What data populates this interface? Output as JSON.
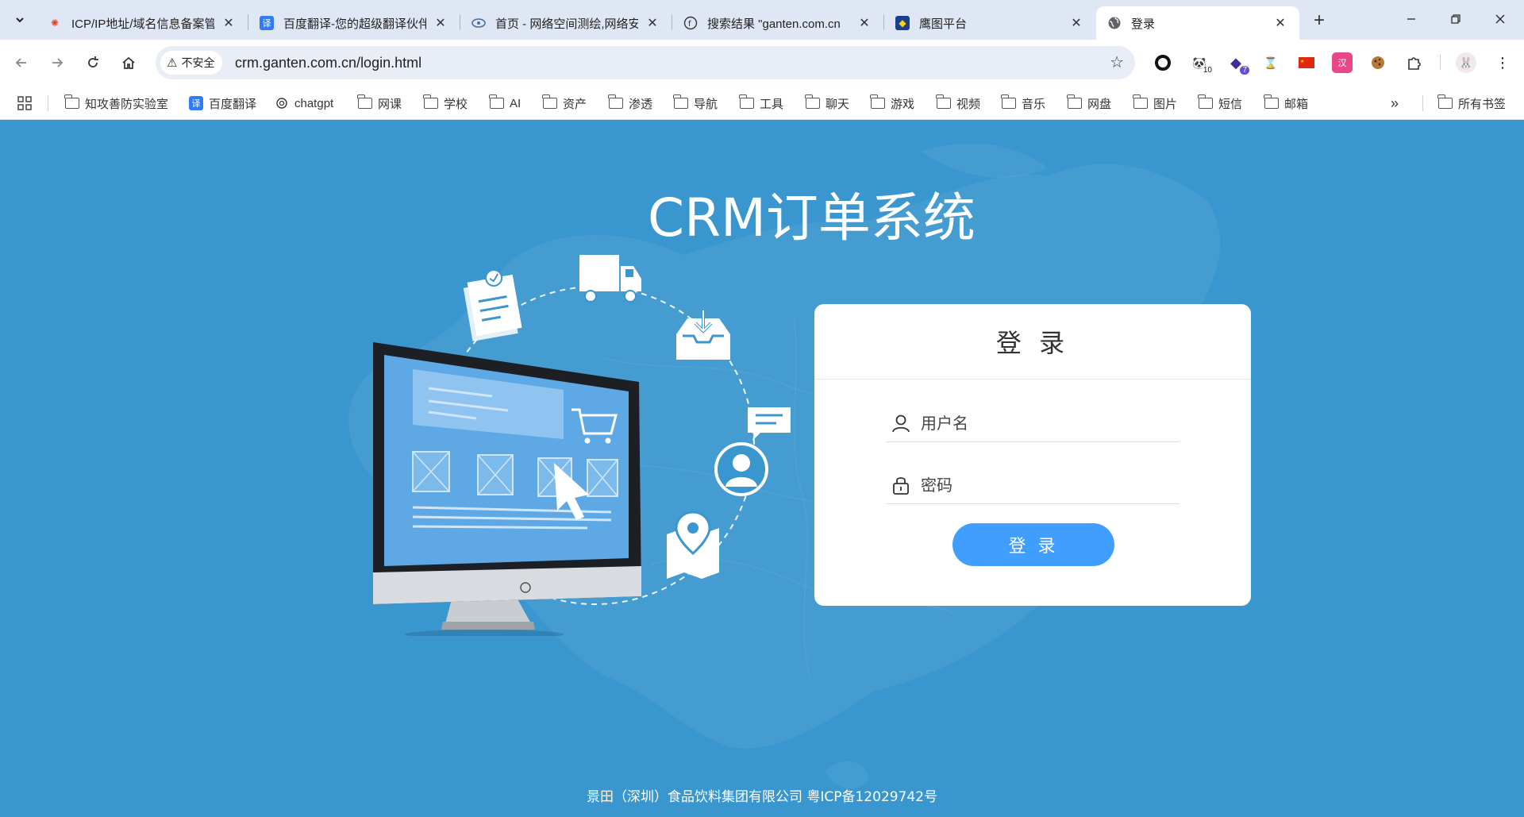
{
  "tabs": [
    {
      "title": "ICP/IP地址/域名信息备案管",
      "favicon": "icp-icon"
    },
    {
      "title": "百度翻译-您的超级翻译伙伴",
      "favicon": "translate-icon"
    },
    {
      "title": "首页 - 网络空间测绘,网络安",
      "favicon": "eye-icon"
    },
    {
      "title": "搜索结果 \"ganten.com.cn",
      "favicon": "fofa-icon"
    },
    {
      "title": "鹰图平台",
      "favicon": "hawk-icon"
    },
    {
      "title": "登录",
      "favicon": "globe-icon",
      "active": true
    }
  ],
  "toolbar": {
    "security_label": "不安全",
    "url": "crm.ganten.com.cn/login.html",
    "ext_badges": {
      "ext2": "10",
      "ext3": "7"
    }
  },
  "bookmarks": [
    {
      "label": "知攻善防实验室",
      "icon": "folder-icon"
    },
    {
      "label": "百度翻译",
      "icon": "translate-icon"
    },
    {
      "label": "chatgpt",
      "icon": "openai-icon"
    },
    {
      "label": "网课",
      "icon": "folder-icon"
    },
    {
      "label": "学校",
      "icon": "folder-icon"
    },
    {
      "label": "AI",
      "icon": "folder-icon"
    },
    {
      "label": "资产",
      "icon": "folder-icon"
    },
    {
      "label": "渗透",
      "icon": "folder-icon"
    },
    {
      "label": "导航",
      "icon": "folder-icon"
    },
    {
      "label": "工具",
      "icon": "folder-icon"
    },
    {
      "label": "聊天",
      "icon": "folder-icon"
    },
    {
      "label": "游戏",
      "icon": "folder-icon"
    },
    {
      "label": "视频",
      "icon": "folder-icon"
    },
    {
      "label": "音乐",
      "icon": "folder-icon"
    },
    {
      "label": "网盘",
      "icon": "folder-icon"
    },
    {
      "label": "图片",
      "icon": "folder-icon"
    },
    {
      "label": "短信",
      "icon": "folder-icon"
    },
    {
      "label": "邮箱",
      "icon": "folder-icon"
    }
  ],
  "all_bookmarks_label": "所有书签",
  "page": {
    "title": "CRM订单系统",
    "login": {
      "heading": "登 录",
      "username_placeholder": "用户名",
      "password_placeholder": "密码",
      "button_label": "登 录"
    },
    "footer": "景田（深圳）食品饮料集团有限公司 粤ICP备12029742号"
  },
  "colors": {
    "page_bg": "#3a96cf",
    "button": "#409eff",
    "tabstrip": "#dfe7f5"
  }
}
